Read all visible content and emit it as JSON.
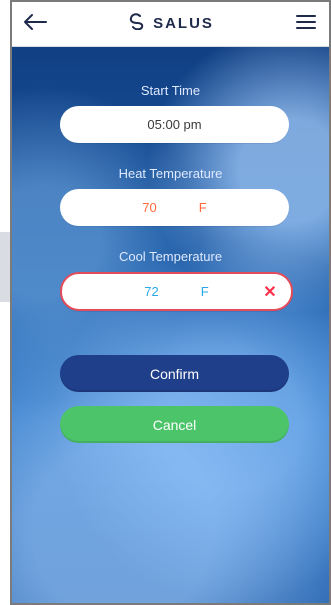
{
  "header": {
    "brand": "SALUS"
  },
  "form": {
    "start_time_label": "Start Time",
    "start_time_value": "05:00 pm",
    "heat_label": "Heat Temperature",
    "heat_value": "70",
    "heat_unit": "F",
    "cool_label": "Cool Temperature",
    "cool_value": "72",
    "cool_unit": "F"
  },
  "buttons": {
    "confirm": "Confirm",
    "cancel": "Cancel"
  },
  "icons": {
    "back": "back-arrow-icon",
    "menu": "hamburger-menu-icon",
    "logo": "salus-logo-icon",
    "clear": "clear-x-icon"
  },
  "colors": {
    "heat": "#ff6a3d",
    "cool": "#2aa7e6",
    "cool_border": "#e44b5b",
    "confirm": "#1f3f8a",
    "cancel": "#4cc56a"
  }
}
